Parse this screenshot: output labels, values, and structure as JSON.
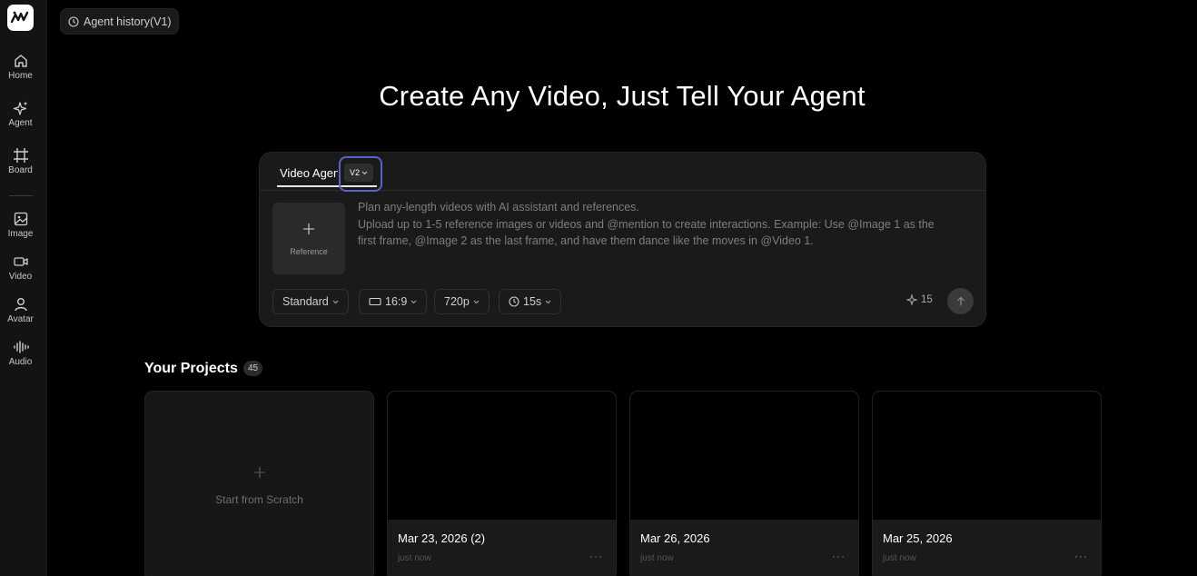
{
  "sidebar": {
    "items": [
      {
        "label": "Home",
        "icon": "home-icon"
      },
      {
        "label": "Agent",
        "icon": "sparkle-icon"
      },
      {
        "label": "Board",
        "icon": "board-icon"
      },
      {
        "label": "Image",
        "icon": "image-icon"
      },
      {
        "label": "Video",
        "icon": "video-icon"
      },
      {
        "label": "Avatar",
        "icon": "avatar-icon"
      },
      {
        "label": "Audio",
        "icon": "audio-icon"
      }
    ]
  },
  "header": {
    "history_label": "Agent history(V1)"
  },
  "hero": {
    "title": "Create Any Video, Just Tell Your Agent"
  },
  "composer": {
    "tab_label": "Video Agent",
    "version": "V2",
    "reference_label": "Reference",
    "prompt_lines": [
      "Plan any-length videos with AI assistant and references.",
      "Upload up to 1-5 reference images or videos and @mention to create interactions. Example: Use @Image 1 as the",
      "first frame, @Image 2 as the last frame, and have them dance like the moves in @Video 1."
    ],
    "options": {
      "quality": "Standard",
      "aspect_ratio": "16:9",
      "resolution": "720p",
      "duration": "15s"
    },
    "credits": "15"
  },
  "projects": {
    "title": "Your Projects",
    "count": "45",
    "scratch_label": "Start from Scratch",
    "cards": [
      {
        "title": "Mar 23, 2026 (2)",
        "time": "just now"
      },
      {
        "title": "Mar 26, 2026",
        "time": "just now"
      },
      {
        "title": "Mar 25, 2026",
        "time": "just now"
      }
    ],
    "more_label": "···"
  },
  "colors": {
    "background": "#000000",
    "sidebar": "#131313",
    "card": "#1a1a1a",
    "highlight": "#5c5fcf"
  }
}
